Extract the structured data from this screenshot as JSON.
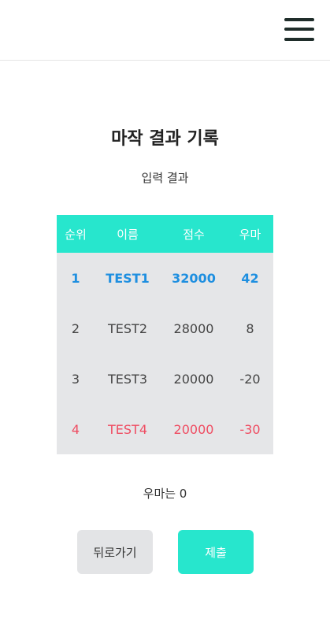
{
  "header": {
    "menu_icon": "hamburger-menu-icon"
  },
  "page": {
    "title": "마작 결과 기록",
    "subtitle": "입력 결과"
  },
  "table": {
    "columns": [
      "순위",
      "이름",
      "점수",
      "우마"
    ],
    "rows": [
      {
        "rank": "1",
        "name": "TEST1",
        "score": "32000",
        "uma": "42"
      },
      {
        "rank": "2",
        "name": "TEST2",
        "score": "28000",
        "uma": "8"
      },
      {
        "rank": "3",
        "name": "TEST3",
        "score": "20000",
        "uma": "-20"
      },
      {
        "rank": "4",
        "name": "TEST4",
        "score": "20000",
        "uma": "-30"
      }
    ]
  },
  "uma_total": "우마는 0",
  "buttons": {
    "back": "뒤로가기",
    "submit": "제출"
  },
  "colors": {
    "accent": "#27e6cd",
    "first_place": "#1e8fe0",
    "last_place": "#ef4d62",
    "table_bg": "#e5e6e8"
  }
}
